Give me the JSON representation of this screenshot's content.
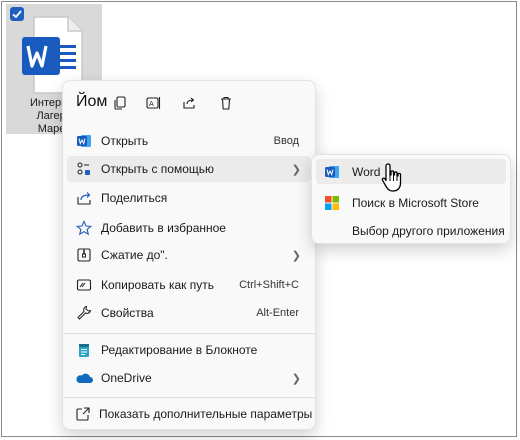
{
  "file": {
    "label_lines": [
      "Интернет",
      "Лагерь",
      "Марек"
    ]
  },
  "menu": {
    "quick_name": "Йом",
    "quick_actions": [
      "copy-icon",
      "rename-icon",
      "share-icon",
      "delete-icon"
    ],
    "items": [
      {
        "label": "Открыть",
        "shortcut": "Ввод",
        "icon": "word-icon"
      },
      {
        "label": "Открыть с помощью",
        "icon": "open-with-icon",
        "submenu": true
      },
      {
        "label": "Поделиться",
        "icon": "share-icon"
      },
      {
        "label": "Добавить в избранное",
        "icon": "star-icon"
      },
      {
        "label": "Сжатие до\".",
        "icon": "archive-icon",
        "submenu": true
      },
      {
        "label": "Копировать как путь",
        "shortcut": "Ctrl+Shift+C",
        "icon": "path-icon"
      },
      {
        "label": "Свойства",
        "shortcut": "Alt-Enter",
        "icon": "wrench-icon"
      },
      {
        "label": "Редактирование в Блокноте",
        "icon": "notepad-icon"
      },
      {
        "label": "OneDrive",
        "icon": "onedrive-icon",
        "submenu": true
      },
      {
        "label": "Показать дополнительные параметры",
        "icon": "more-options-icon"
      }
    ]
  },
  "submenu": {
    "items": [
      {
        "label": "Word",
        "icon": "word-icon"
      },
      {
        "label": "Поиск в Microsoft Store",
        "icon": "store-icon"
      },
      {
        "label": "Выбор другого приложения",
        "icon": ""
      }
    ]
  },
  "colors": {
    "word_blue": "#185abd",
    "accent": "#1f5fbf",
    "menu_bg": "#f9f9f9",
    "hover_bg": "#ebebeb",
    "tile_selected": "#d9d9d9"
  }
}
